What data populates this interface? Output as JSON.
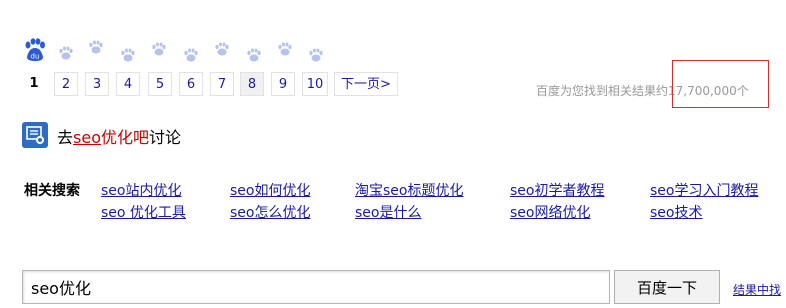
{
  "pager": {
    "current": "1",
    "pages": [
      "2",
      "3",
      "4",
      "5",
      "6",
      "7",
      "8",
      "9",
      "10"
    ],
    "visited_page": "8",
    "next_label": "下一页>"
  },
  "result_count_text": "百度为您找到相关结果约17,700,000个",
  "tieba": {
    "prefix": "去",
    "keyword": "seo",
    "link_tail": "优化吧",
    "suffix": "讨论"
  },
  "related": {
    "title": "相关搜索",
    "row1": [
      "seo站内优化",
      "seo如何优化",
      "淘宝seo标题优化",
      "seo初学者教程",
      "seo学习入门教程"
    ],
    "row2": [
      "seo 优化工具",
      "seo怎么优化",
      "seo是什么",
      "seo网络优化",
      "seo技术"
    ]
  },
  "search": {
    "value": "seo优化",
    "button_label": "百度一下",
    "search_in_results": "结果中找"
  },
  "colors": {
    "link": "#1a1aa6",
    "keyword": "#cc0000",
    "paw_active": "#2b5bd6",
    "paw_inactive": "#b7c4ea",
    "highlight_box": "#d03030"
  }
}
